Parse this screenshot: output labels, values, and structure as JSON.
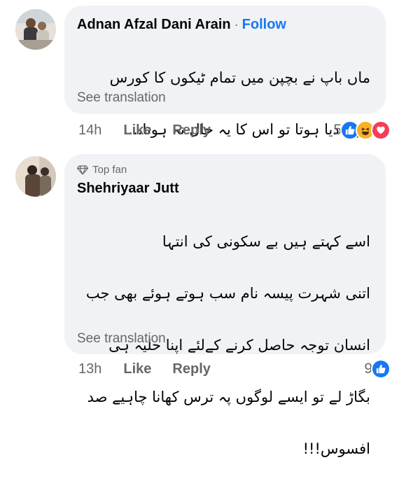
{
  "comments": [
    {
      "author": "Adnan Afzal Dani Arain",
      "separator": "·",
      "follow_label": "Follow",
      "text_lines": [
        "ماں باپ نے بچپن میں تمام ٹیکوں کا کورس",
        "کروا دیا ہوتا تو اس کا یہ حال نہ ہوتا...."
      ],
      "see_translation": "See translation",
      "time": "14h",
      "like_label": "Like",
      "reply_label": "Reply",
      "reaction_count": "5",
      "reactions": [
        "like-icon",
        "haha-icon",
        "love-icon"
      ]
    },
    {
      "badge": "Top fan",
      "author": "Shehriyaar Jutt",
      "text_lines": [
        "اسے کہتے ہیں بے سکونی کی انتہا",
        "اتنی شہرت پیسہ نام سب ہوتے ہوئے بھی جب",
        "انسان توجہ حاصل کرنے کےلئے اپنا حلیہ ہی",
        "بگاڑ لے تو ایسے لوگوں پہ ترس کھانا چاہیے صد",
        "افسوس!!!"
      ],
      "see_translation": "See translation",
      "time": "13h",
      "like_label": "Like",
      "reply_label": "Reply",
      "reaction_count": "9",
      "reactions": [
        "like-icon"
      ]
    }
  ],
  "colors": {
    "bubble": "#f0f2f5",
    "follow": "#1877f2",
    "meta": "#65676b",
    "like": "#1877f2",
    "haha": "#f7b125",
    "love": "#f33e58"
  }
}
